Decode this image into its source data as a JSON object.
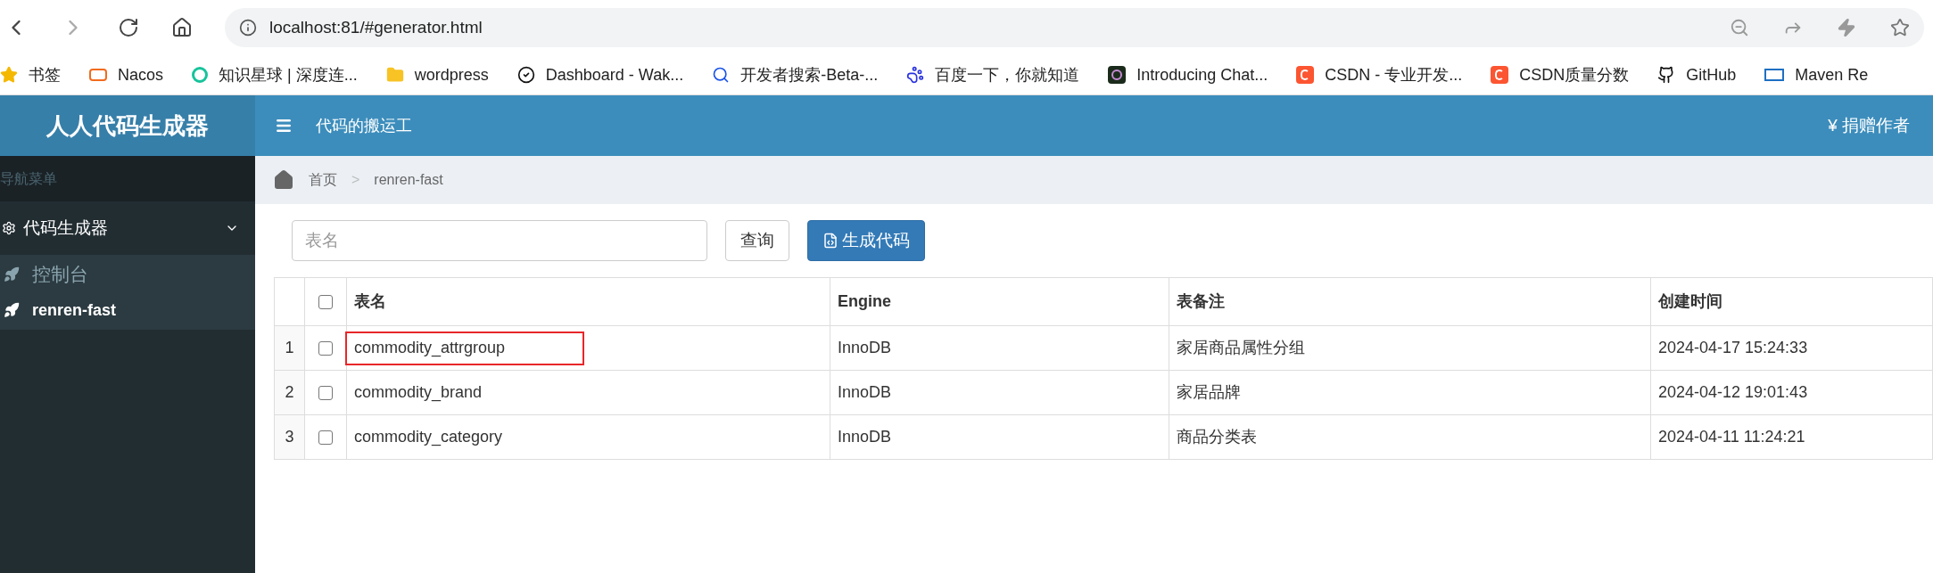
{
  "browser": {
    "url": "localhost:81/#generator.html",
    "bookmarks": [
      {
        "label": "书签",
        "kind": "star"
      },
      {
        "label": "Nacos",
        "kind": "nacos"
      },
      {
        "label": "知识星球 | 深度连...",
        "kind": "ring"
      },
      {
        "label": "wordpress",
        "kind": "folder"
      },
      {
        "label": "Dashboard - Wak...",
        "kind": "check"
      },
      {
        "label": "开发者搜索-Beta-...",
        "kind": "search"
      },
      {
        "label": "百度一下，你就知道",
        "kind": "paw"
      },
      {
        "label": "Introducing Chat...",
        "kind": "knot"
      },
      {
        "label": "CSDN - 专业开发...",
        "kind": "csdn"
      },
      {
        "label": "CSDN质量分数",
        "kind": "csdn"
      },
      {
        "label": "GitHub",
        "kind": "github"
      },
      {
        "label": "Maven Re",
        "kind": "mvn"
      }
    ]
  },
  "app": {
    "logo": "人人代码生成器",
    "header_title": "代码的搬运工",
    "donate": "¥ 捐赠作者"
  },
  "sidebar": {
    "heading": "导航菜单",
    "group": {
      "label": "代码生成器",
      "expanded": true,
      "children": [
        {
          "label": "控制台",
          "selected": false
        },
        {
          "label": "renren-fast",
          "selected": true
        }
      ]
    }
  },
  "breadcrumb": {
    "separator": ">",
    "items": [
      "首页",
      "renren-fast"
    ]
  },
  "search": {
    "placeholder": "表名",
    "query_button": "查询",
    "generate_button": "生成代码"
  },
  "table": {
    "all_checked": false,
    "columns": [
      "表名",
      "Engine",
      "表备注",
      "创建时间"
    ],
    "rows": [
      {
        "index": "1",
        "checked": false,
        "highlighted": true,
        "cells": [
          "commodity_attrgroup",
          "InnoDB",
          "家居商品属性分组",
          "2024-04-17 15:24:33"
        ]
      },
      {
        "index": "2",
        "checked": false,
        "highlighted": false,
        "cells": [
          "commodity_brand",
          "InnoDB",
          "家居品牌",
          "2024-04-12 19:01:43"
        ]
      },
      {
        "index": "3",
        "checked": false,
        "highlighted": false,
        "cells": [
          "commodity_category",
          "InnoDB",
          "商品分类表",
          "2024-04-11 11:24:21"
        ]
      }
    ]
  }
}
